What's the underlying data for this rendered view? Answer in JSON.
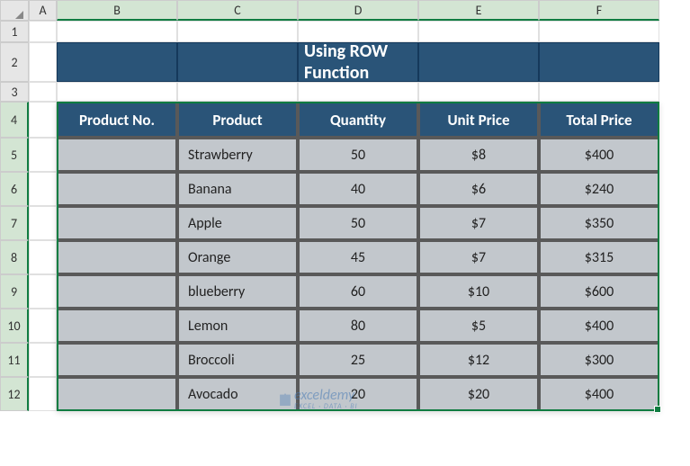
{
  "columns": [
    "",
    "A",
    "B",
    "C",
    "D",
    "E",
    "F"
  ],
  "rows": [
    "1",
    "2",
    "3",
    "4",
    "5",
    "6",
    "7",
    "8",
    "9",
    "10",
    "11",
    "12"
  ],
  "title": "Using ROW Function",
  "chart_data": {
    "type": "table",
    "title": "Using ROW Function",
    "headers": [
      "Product No.",
      "Product",
      "Quantity",
      "Unit Price",
      "Total Price"
    ],
    "data": [
      {
        "product_no": "",
        "product": "Strawberry",
        "quantity": 50,
        "unit_price": "$8",
        "total_price": "$400"
      },
      {
        "product_no": "",
        "product": "Banana",
        "quantity": 40,
        "unit_price": "$6",
        "total_price": "$240"
      },
      {
        "product_no": "",
        "product": "Apple",
        "quantity": 50,
        "unit_price": "$7",
        "total_price": "$350"
      },
      {
        "product_no": "",
        "product": "Orange",
        "quantity": 45,
        "unit_price": "$7",
        "total_price": "$315"
      },
      {
        "product_no": "",
        "product": "blueberry",
        "quantity": 60,
        "unit_price": "$10",
        "total_price": "$600"
      },
      {
        "product_no": "",
        "product": "Lemon",
        "quantity": 80,
        "unit_price": "$5",
        "total_price": "$400"
      },
      {
        "product_no": "",
        "product": "Broccoli",
        "quantity": 25,
        "unit_price": "$12",
        "total_price": "$300"
      },
      {
        "product_no": "",
        "product": "Avocado",
        "quantity": 20,
        "unit_price": "$20",
        "total_price": "$400"
      }
    ]
  },
  "watermark": "exceldemy",
  "watermark_sub": "EXCEL · DATA · BI"
}
